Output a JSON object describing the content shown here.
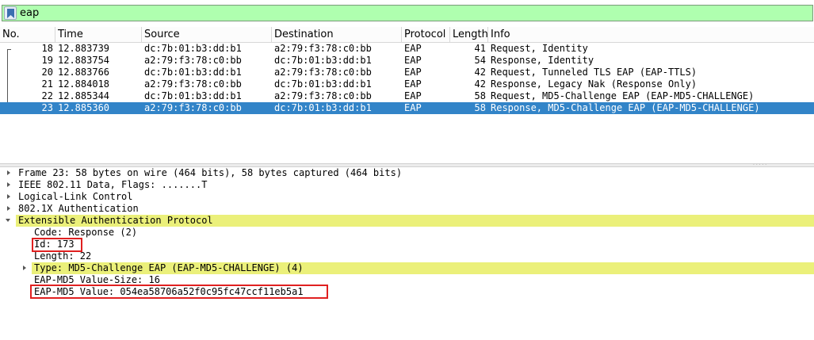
{
  "filter": {
    "value": "eap",
    "background": "#afffaf"
  },
  "columns": [
    "No.",
    "Time",
    "Source",
    "Destination",
    "Protocol",
    "Length",
    "Info"
  ],
  "packets": [
    {
      "no": "18",
      "time": "12.883739",
      "source": "dc:7b:01:b3:dd:b1",
      "destination": "a2:79:f3:78:c0:bb",
      "protocol": "EAP",
      "length": "41",
      "info": "Request, Identity"
    },
    {
      "no": "19",
      "time": "12.883754",
      "source": "a2:79:f3:78:c0:bb",
      "destination": "dc:7b:01:b3:dd:b1",
      "protocol": "EAP",
      "length": "54",
      "info": "Response, Identity"
    },
    {
      "no": "20",
      "time": "12.883766",
      "source": "dc:7b:01:b3:dd:b1",
      "destination": "a2:79:f3:78:c0:bb",
      "protocol": "EAP",
      "length": "42",
      "info": "Request, Tunneled TLS EAP (EAP-TTLS)"
    },
    {
      "no": "21",
      "time": "12.884018",
      "source": "a2:79:f3:78:c0:bb",
      "destination": "dc:7b:01:b3:dd:b1",
      "protocol": "EAP",
      "length": "42",
      "info": "Response, Legacy Nak (Response Only)"
    },
    {
      "no": "22",
      "time": "12.885344",
      "source": "dc:7b:01:b3:dd:b1",
      "destination": "a2:79:f3:78:c0:bb",
      "protocol": "EAP",
      "length": "58",
      "info": "Request, MD5-Challenge EAP (EAP-MD5-CHALLENGE)"
    },
    {
      "no": "23",
      "time": "12.885360",
      "source": "a2:79:f3:78:c0:bb",
      "destination": "dc:7b:01:b3:dd:b1",
      "protocol": "EAP",
      "length": "58",
      "info": "Response, MD5-Challenge EAP (EAP-MD5-CHALLENGE)",
      "selected": true
    }
  ],
  "details": {
    "frame": "Frame 23: 58 bytes on wire (464 bits), 58 bytes captured (464 bits)",
    "ieee": "IEEE 802.11 Data, Flags: .......T",
    "llc": "Logical-Link Control",
    "dot1x": "802.1X Authentication",
    "eap": "Extensible Authentication Protocol",
    "code": "Code: Response (2)",
    "id": "Id: 173",
    "length": "Length: 22",
    "type": "Type: MD5-Challenge EAP (EAP-MD5-CHALLENGE) (4)",
    "value_size": "EAP-MD5 Value-Size: 16",
    "value": "EAP-MD5 Value: 054ea58706a52f0c95fc47ccf11eb5a1"
  },
  "colors": {
    "selected_row": "#3284c8",
    "highlight": "#ebf07a",
    "annotation_box": "#e02020"
  }
}
